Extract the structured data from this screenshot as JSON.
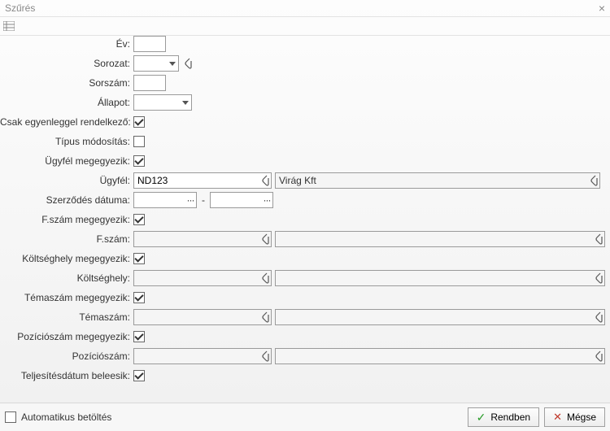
{
  "window": {
    "title": "Szűrés"
  },
  "labels": {
    "ev": "Év:",
    "sorozat": "Sorozat:",
    "sorszam": "Sorszám:",
    "allapot": "Állapot:",
    "egyenleg": "Csak egyenleggel rendelkező:",
    "tipusmod": "Típus módosítás:",
    "ugyfel_megegyezik": "Ügyfél megegyezik:",
    "ugyfel": "Ügyfél:",
    "szerzodes": "Szerződés dátuma:",
    "fszam_megegyezik": "F.szám megegyezik:",
    "fszam": "F.szám:",
    "koltseghely_megegyezik": "Költséghely megegyezik:",
    "koltseghely": "Költséghely:",
    "temaszam_megegyezik": "Témaszám megegyezik:",
    "temaszam": "Témaszám:",
    "pozicioszam_megegyezik": "Pozíciószám megegyezik:",
    "pozicioszam": "Pozíciószám:",
    "teljesites": "Teljesítésdátum beleesik:"
  },
  "values": {
    "ev": "",
    "sorozat": "",
    "sorszam": "",
    "allapot": "",
    "ugyfel_code": "ND123",
    "ugyfel_name": "Virág Kft",
    "szerzodes_from": "",
    "szerzodes_to": "",
    "fszam_a": "",
    "fszam_b": "",
    "koltseghely_a": "",
    "koltseghely_b": "",
    "temaszam_a": "",
    "temaszam_b": "",
    "pozicioszam_a": "",
    "pozicioszam_b": ""
  },
  "checks": {
    "egyenleg": true,
    "tipusmod": false,
    "ugyfel_megegyezik": true,
    "fszam_megegyezik": true,
    "koltseghely_megegyezik": true,
    "temaszam_megegyezik": true,
    "pozicioszam_megegyezik": true,
    "teljesites": true,
    "auto_load": false
  },
  "footer": {
    "auto_load": "Automatikus betöltés",
    "ok": "Rendben",
    "cancel": "Mégse"
  },
  "dash": "-"
}
